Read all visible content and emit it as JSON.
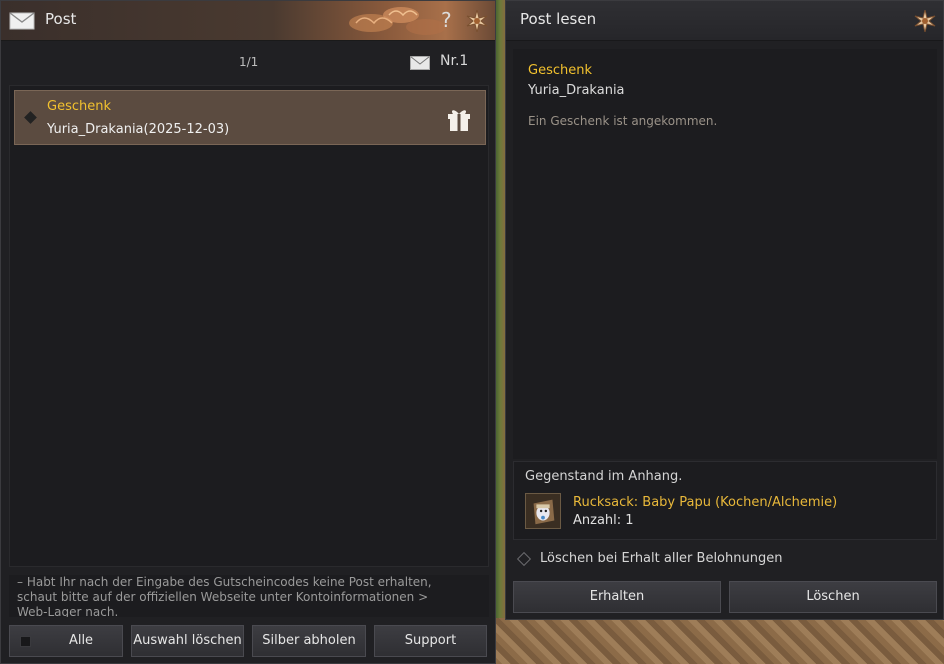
{
  "post_window": {
    "title": "Post",
    "help_glyph": "?",
    "pager": "1/1",
    "mail_count": "Nr.1",
    "mails": [
      {
        "subject": "Geschenk",
        "sender_line": "Yuria_Drakania(2025-12-03)",
        "icon": "gift-icon",
        "selected": true
      }
    ],
    "notice_lines": [
      "– Habt Ihr nach der Eingabe des Gutscheincodes keine Post erhalten,",
      "schaut bitte auf der offiziellen Webseite unter Kontoinformationen >",
      "Web-Lager nach."
    ],
    "buttons": {
      "all": "Alle",
      "delete_selected": "Auswahl löschen",
      "collect_silver": "Silber abholen",
      "support": "Support"
    }
  },
  "read_window": {
    "title": "Post lesen",
    "subject": "Geschenk",
    "sender": "Yuria_Drakania",
    "message": "Ein Geschenk ist angekommen.",
    "attachment_heading": "Gegenstand im Anhang.",
    "attachment": {
      "name": "Rucksack: Baby Papu (Kochen/Alchemie)",
      "quantity": "Anzahl: 1",
      "icon": "backpack-pet-icon"
    },
    "delete_option_label": "Löschen bei Erhalt aller Belohnungen",
    "buttons": {
      "receive": "Erhalten",
      "delete": "Löschen"
    }
  },
  "colors": {
    "panel_bg": "#202023",
    "accent_gold": "#f2c12e",
    "item_gold": "#e8b83a",
    "selected_row": "#5b4b40"
  }
}
